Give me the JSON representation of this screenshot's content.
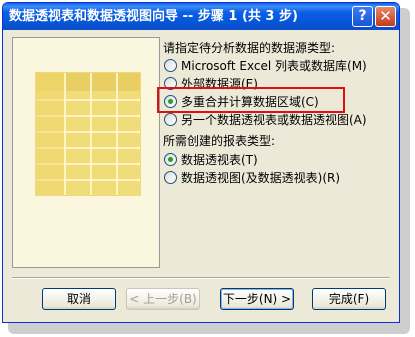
{
  "window": {
    "title": "数据透视表和数据透视图向导 -- 步骤 1 (共 3 步)",
    "help_label": "?",
    "close_label": "✕"
  },
  "source_section": {
    "label": "请指定待分析数据的数据源类型:",
    "options": [
      {
        "label": "Microsoft Excel 列表或数据库(M)",
        "selected": false
      },
      {
        "label": "外部数据源(E)",
        "selected": false
      },
      {
        "label": "多重合并计算数据区域(C)",
        "selected": true
      },
      {
        "label": "另一个数据透视表或数据透视图(A)",
        "selected": false
      }
    ]
  },
  "report_section": {
    "label": "所需创建的报表类型:",
    "options": [
      {
        "label": "数据透视表(T)",
        "selected": true
      },
      {
        "label": "数据透视图(及数据透视表)(R)",
        "selected": false
      }
    ]
  },
  "buttons": {
    "cancel": "取消",
    "back": "< 上一步(B)",
    "next": "下一步(N) >",
    "finish": "完成(F)"
  },
  "colors": {
    "titlebar": "#0a5ee6",
    "dialog_bg": "#ece9d8",
    "highlight": "#e01010",
    "illustration": "#f1dc7a"
  }
}
